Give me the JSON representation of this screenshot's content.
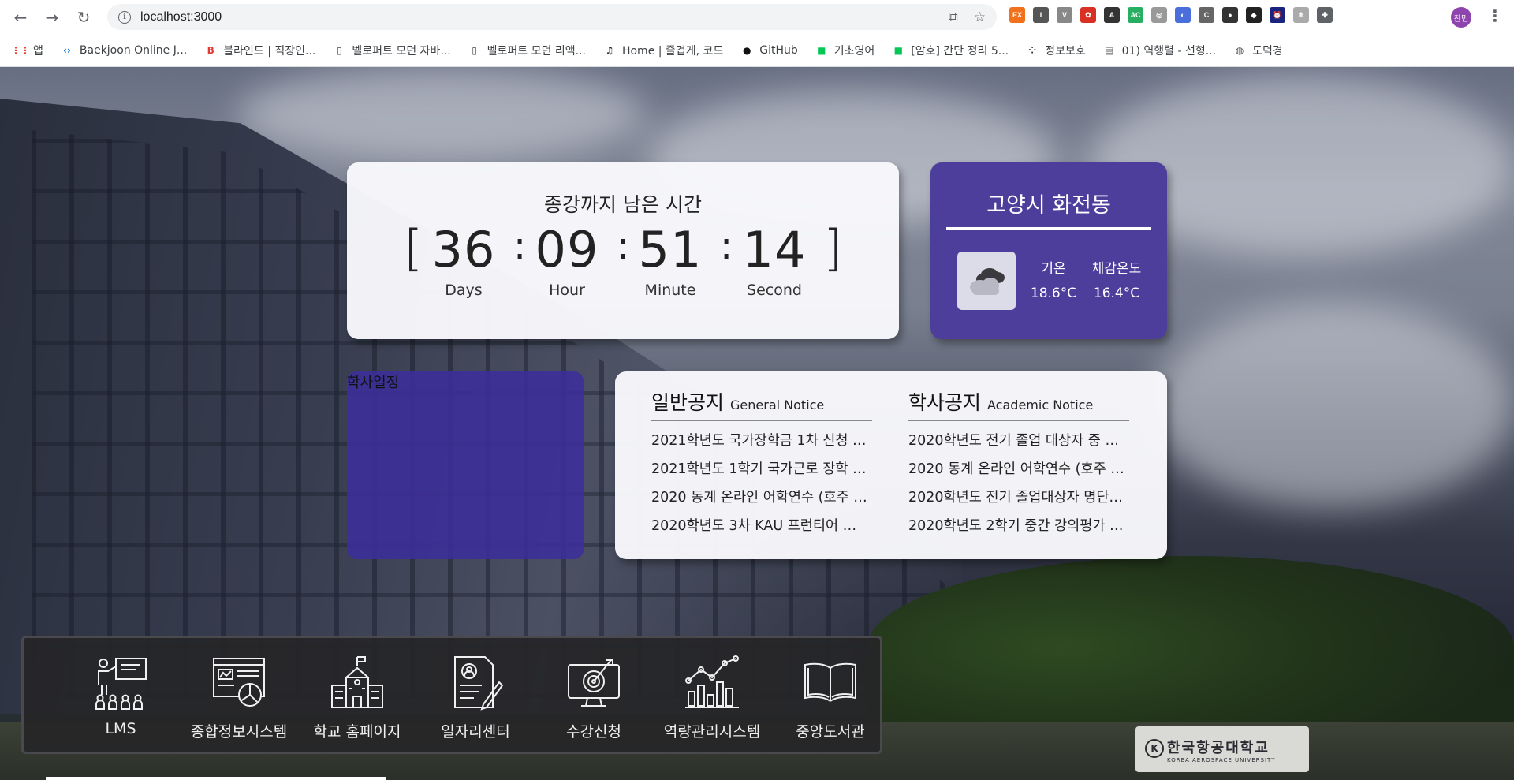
{
  "browser": {
    "url": "localhost:3000",
    "profile_label": "찬민",
    "extensions": [
      {
        "name": "ex-extension-icon",
        "label": "EX",
        "color": "#f2711c"
      },
      {
        "name": "i-extension-icon",
        "label": "I",
        "color": "#555555"
      },
      {
        "name": "v-extension-icon",
        "label": "V",
        "color": "#888888"
      },
      {
        "name": "red-extension-icon",
        "label": "✿",
        "color": "#d93025"
      },
      {
        "name": "dark-extension-icon",
        "label": "A",
        "color": "#333333"
      },
      {
        "name": "ac-extension-icon",
        "label": "AC",
        "color": "#27ae60"
      },
      {
        "name": "eye-extension-icon",
        "label": "◎",
        "color": "#999999"
      },
      {
        "name": "blue-extension-icon",
        "label": "◐",
        "color": "#4a6fdc"
      },
      {
        "name": "c-extension-icon",
        "label": "C",
        "color": "#666666"
      },
      {
        "name": "circle-extension-icon",
        "label": "●",
        "color": "#333333"
      },
      {
        "name": "tag-extension-icon",
        "label": "◆",
        "color": "#222222"
      },
      {
        "name": "alarm-extension-icon",
        "label": "⏰",
        "color": "#1a237e"
      },
      {
        "name": "react-extension-icon",
        "label": "⚛",
        "color": "#aaaaaa"
      },
      {
        "name": "puzzle-extension-icon",
        "label": "✚",
        "color": "#5f6368"
      }
    ]
  },
  "bookmarks": [
    {
      "name": "bookmark-apps",
      "icon": "apps-grid-icon",
      "label": "앱"
    },
    {
      "name": "bookmark-baekjoon",
      "icon": "code-icon",
      "label": "Baekjoon Online J..."
    },
    {
      "name": "bookmark-blind",
      "icon": "blind-icon",
      "label": "블라인드 | 직장인..."
    },
    {
      "name": "bookmark-velopert-js",
      "icon": "book-icon",
      "label": "벨로퍼트 모던 자바..."
    },
    {
      "name": "bookmark-velopert-react",
      "icon": "book-icon",
      "label": "벨로퍼트 모던 리액..."
    },
    {
      "name": "bookmark-home",
      "icon": "music-icon",
      "label": "Home | 즐겁게, 코드"
    },
    {
      "name": "bookmark-github",
      "icon": "github-icon",
      "label": "GitHub"
    },
    {
      "name": "bookmark-english",
      "icon": "line-icon",
      "label": "기초영어"
    },
    {
      "name": "bookmark-crypto",
      "icon": "line-icon",
      "label": "[암호] 간단 정리 5..."
    },
    {
      "name": "bookmark-security",
      "icon": "dots-icon",
      "label": "정보보호"
    },
    {
      "name": "bookmark-matrix",
      "icon": "notebook-icon",
      "label": "01) 역행렬 - 선형..."
    },
    {
      "name": "bookmark-dodeok",
      "icon": "globe-icon",
      "label": "도덕경"
    }
  ],
  "countdown": {
    "title": "종강까지 남은 시간",
    "open_bracket": "[",
    "close_bracket": "]",
    "colon": ":",
    "days": "36",
    "hours": "09",
    "minutes": "51",
    "seconds": "14",
    "days_label": "Days",
    "hours_label": "Hour",
    "minutes_label": "Minute",
    "seconds_label": "Second"
  },
  "weather": {
    "location": "고양시 화전동",
    "icon": "cloudy-icon",
    "temp_label": "기온",
    "feels_label": "체감온도",
    "temp_value": "18.6°C",
    "feels_value": "16.4°C"
  },
  "schedule": {
    "title": "학사일정"
  },
  "notices": {
    "general": {
      "title": "일반공지",
      "subtitle": "General Notice",
      "items": [
        "2021학년도 국가장학금 1차 신청 …",
        "2021학년도 1학기 국가근로 장학 …",
        "2020 동계 온라인 어학연수 (호주 …",
        "2020학년도 3차 KAU 프런티어 …"
      ]
    },
    "academic": {
      "title": "학사공지",
      "subtitle": "Academic Notice",
      "items": [
        "2020학년도 전기 졸업 대상자 중 …",
        "2020 동계 온라인 어학연수 (호주 …",
        "2020학년도 전기 졸업대상자 명단…",
        "2020학년도 2학기 중간 강의평가 …"
      ]
    }
  },
  "quicklinks": [
    {
      "name": "lms",
      "icon": "lecture-icon",
      "label": "LMS"
    },
    {
      "name": "info-system",
      "icon": "dashboard-icon",
      "label": "종합정보시스템"
    },
    {
      "name": "homepage",
      "icon": "school-icon",
      "label": "학교 홈페이지"
    },
    {
      "name": "job-center",
      "icon": "resume-icon",
      "label": "일자리센터"
    },
    {
      "name": "course-registration",
      "icon": "target-monitor-icon",
      "label": "수강신청"
    },
    {
      "name": "competency",
      "icon": "chart-icon",
      "label": "역량관리시스템"
    },
    {
      "name": "library",
      "icon": "open-book-icon",
      "label": "중앙도서관"
    }
  ],
  "campus_sign": {
    "title": "한국항공대학교",
    "subtitle": "KOREA AEROSPACE UNIVERSITY"
  }
}
